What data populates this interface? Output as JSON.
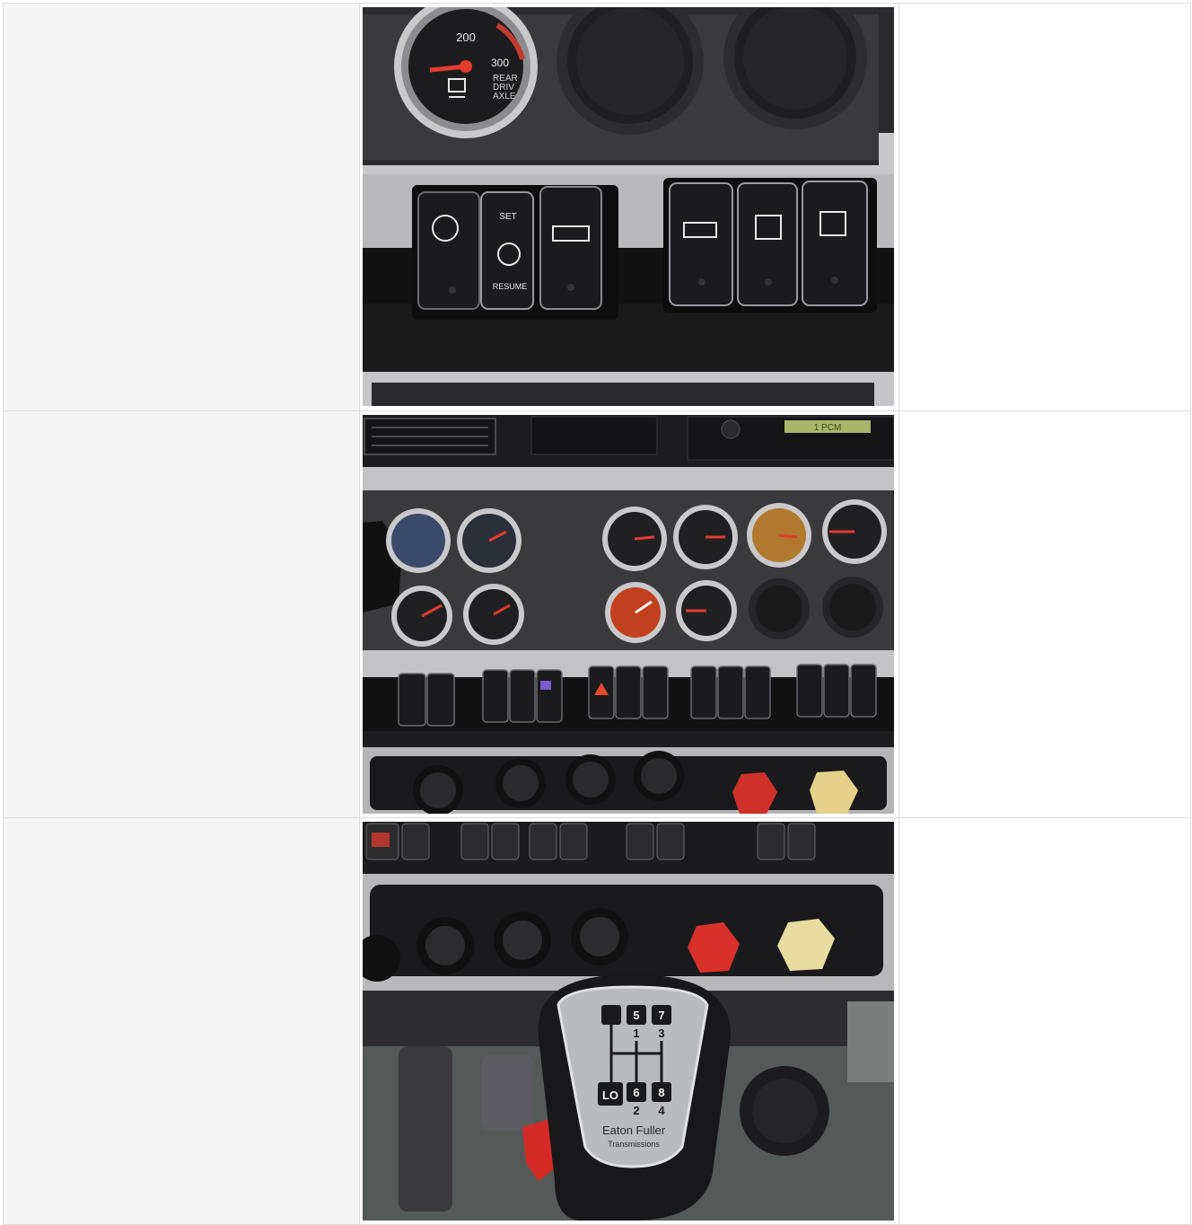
{
  "rows": [
    {
      "photo": {
        "gauge_labels": [
          "200",
          "300",
          "REAR",
          "DRIV",
          "AXLE"
        ],
        "switch_labels": [
          "SET",
          "RESUME"
        ]
      }
    },
    {
      "photo": {
        "radio_display": "1 PCM"
      }
    },
    {
      "photo": {
        "shift_pattern": [
          "5",
          "7",
          "1",
          "3",
          "LO",
          "6",
          "8",
          "2",
          "4"
        ],
        "brand_line1": "Eaton Fuller",
        "brand_line2": "Transmissions"
      }
    }
  ]
}
